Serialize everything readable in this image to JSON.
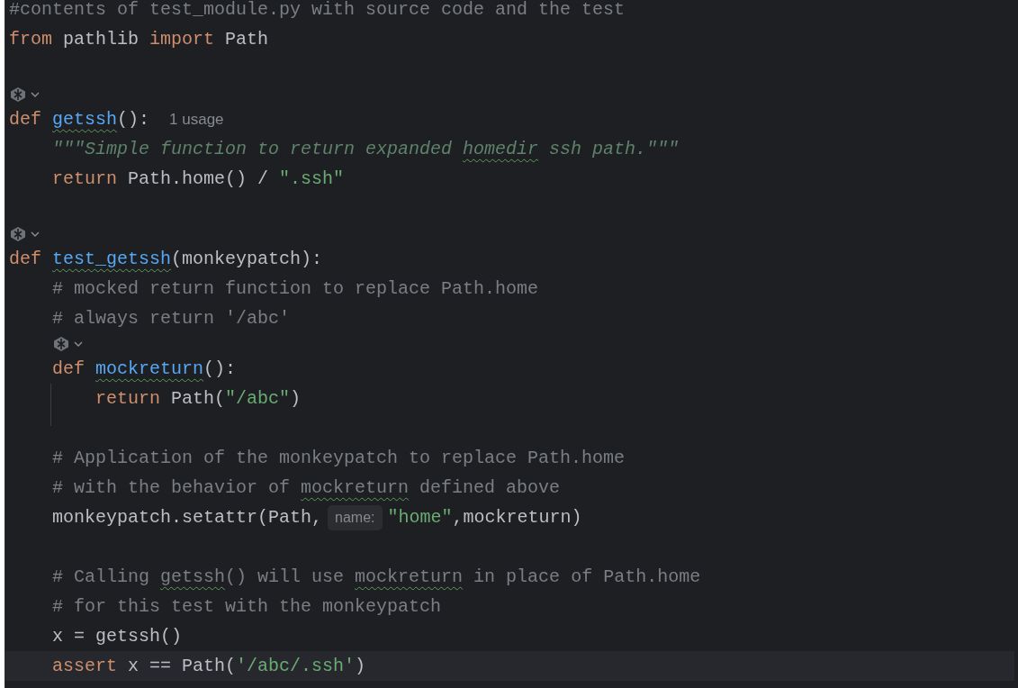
{
  "editor": {
    "lines": [
      {
        "kind": "code",
        "tokens": [
          {
            "kind": "comment",
            "text": "#contents of test_module.py with source code and the test"
          }
        ]
      },
      {
        "kind": "code",
        "tokens": [
          {
            "kind": "keyword",
            "text": "from"
          },
          {
            "kind": "plain",
            "text": "pathlib"
          },
          {
            "kind": "keyword",
            "text": "import"
          },
          {
            "kind": "plain",
            "text": "Path"
          }
        ]
      },
      {
        "kind": "blank"
      },
      {
        "kind": "inlay-icons"
      },
      {
        "kind": "code",
        "tokens": [
          {
            "kind": "keyword",
            "text": "def"
          },
          {
            "kind": "function",
            "text": "getssh",
            "typo": true
          },
          {
            "kind": "plain",
            "text": "():",
            "joined": true
          },
          {
            "kind": "usage-hint",
            "text": "1 usage"
          }
        ],
        "children": [
          {
            "kind": "code",
            "tokens": [
              {
                "kind": "docstring",
                "text": "\"\"\"Simple function to return expanded"
              },
              {
                "kind": "docstring",
                "text": "homedir",
                "typo": true
              },
              {
                "kind": "docstring",
                "text": "ssh path.\"\"\""
              }
            ]
          },
          {
            "kind": "code",
            "tokens": [
              {
                "kind": "keyword",
                "text": "return"
              },
              {
                "kind": "plain",
                "text": "Path.home() /"
              },
              {
                "kind": "string",
                "text": "\".ssh\""
              }
            ]
          }
        ]
      },
      {
        "kind": "blank"
      },
      {
        "kind": "inlay-icons"
      },
      {
        "kind": "code",
        "tokens": [
          {
            "kind": "keyword",
            "text": "def"
          },
          {
            "kind": "function",
            "text": "test_getssh",
            "typo": true
          },
          {
            "kind": "plain",
            "text": "(monkeypatch):",
            "joined": true
          }
        ],
        "children": [
          {
            "kind": "code",
            "tokens": [
              {
                "kind": "comment",
                "text": "# mocked return function to replace Path.home"
              }
            ]
          },
          {
            "kind": "code",
            "tokens": [
              {
                "kind": "comment",
                "text": "# always return '/abc'"
              }
            ]
          },
          {
            "kind": "inlay-icons"
          },
          {
            "kind": "code",
            "tokens": [
              {
                "kind": "keyword",
                "text": "def"
              },
              {
                "kind": "function",
                "text": "mockreturn",
                "typo": true
              },
              {
                "kind": "plain",
                "text": "():",
                "joined": true
              }
            ],
            "children": [
              {
                "kind": "code",
                "tokens": [
                  {
                    "kind": "keyword",
                    "text": "return"
                  },
                  {
                    "kind": "plain",
                    "text": "Path(",
                    "joined": false
                  },
                  {
                    "kind": "string",
                    "text": "\"/abc\"",
                    "joined": true
                  },
                  {
                    "kind": "plain",
                    "text": ")",
                    "joined": true
                  }
                ]
              }
            ]
          },
          {
            "kind": "blank"
          },
          {
            "kind": "code",
            "tokens": [
              {
                "kind": "comment",
                "text": "# Application of the monkeypatch to replace Path.home"
              }
            ]
          },
          {
            "kind": "code",
            "tokens": [
              {
                "kind": "comment",
                "text": "# with the behavior of"
              },
              {
                "kind": "comment",
                "text": "mockreturn",
                "typo": true
              },
              {
                "kind": "comment",
                "text": "defined above"
              }
            ]
          },
          {
            "kind": "code",
            "tokens": [
              {
                "kind": "plain",
                "text": "monkeypatch.setattr(Path,"
              },
              {
                "kind": "param-hint",
                "text": "name:"
              },
              {
                "kind": "string",
                "text": "\"home\"",
                "joined": true
              },
              {
                "kind": "plain",
                "text": ",mockreturn)",
                "joined": true
              }
            ]
          },
          {
            "kind": "blank"
          },
          {
            "kind": "code",
            "tokens": [
              {
                "kind": "comment",
                "text": "# Calling"
              },
              {
                "kind": "comment",
                "text": "getssh",
                "typo": true
              },
              {
                "kind": "comment",
                "text": "() will use",
                "joined": true
              },
              {
                "kind": "comment",
                "text": "mockreturn",
                "typo": true
              },
              {
                "kind": "comment",
                "text": "in place of Path.home"
              }
            ]
          },
          {
            "kind": "code",
            "tokens": [
              {
                "kind": "comment",
                "text": "# for this test with the monkeypatch"
              }
            ]
          },
          {
            "kind": "code",
            "tokens": [
              {
                "kind": "plain",
                "text": "x = getssh()"
              }
            ]
          },
          {
            "kind": "code",
            "current": true,
            "tokens": [
              {
                "kind": "keyword",
                "text": "assert"
              },
              {
                "kind": "plain",
                "text": "x == Path("
              },
              {
                "kind": "string",
                "text": "'/abc/.ssh'",
                "joined": true
              },
              {
                "kind": "plain",
                "text": ")",
                "joined": true
              }
            ]
          }
        ]
      }
    ]
  }
}
